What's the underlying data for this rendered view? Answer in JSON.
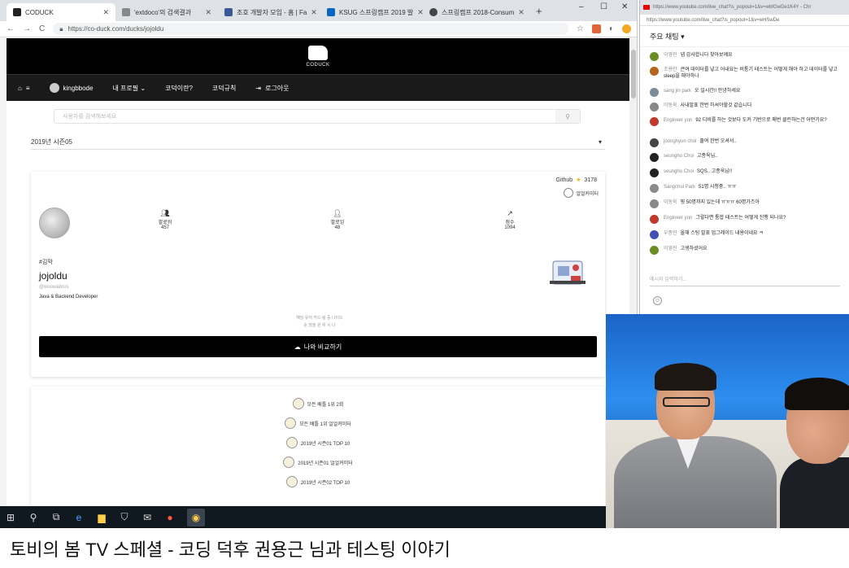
{
  "browser": {
    "tabs": [
      {
        "label": "CODUCK",
        "color": "#222222",
        "active": true
      },
      {
        "label": "'extdoco'의 검색결과",
        "color": "#888888"
      },
      {
        "label": "조호 개발자 모임 - 홈 | Fa",
        "color": "#3b5998"
      },
      {
        "label": "KSUG 스프링캠프 2019 발",
        "color": "#0a66c2"
      },
      {
        "label": "스프링캠프 2018-Consum",
        "color": "#444444"
      }
    ],
    "new_tab": "+",
    "win_min": "–",
    "win_max": "☐",
    "win_close": "✕",
    "url": "https://co-duck.com/ducks/jojoldu",
    "back": "←",
    "forward": "→",
    "reload": "C",
    "star": "☆"
  },
  "site": {
    "logo_text": "CODUCK",
    "nav": [
      "⌂",
      "kingbbode",
      "내 프로필 ⌄",
      "코덕이란?",
      "코덕규칙",
      "로그아웃"
    ],
    "search_placeholder": "사용자를 검색해보세요",
    "search_icon": "⚲",
    "season": "2019년 시즌05",
    "season_caret": "▾"
  },
  "profile": {
    "github_label": "Github",
    "github_stars": "3178",
    "badge_label": "얼얼커미터",
    "stats": [
      {
        "icon": "people-icon",
        "label": "팔로워",
        "value": "457"
      },
      {
        "icon": "person-add-icon",
        "label": "팔로잉",
        "value": "48"
      },
      {
        "icon": "trend-icon",
        "label": "점수",
        "value": "1094"
      }
    ],
    "hashtag": "#김막",
    "username": "jojoldu",
    "handle": "@woowabros",
    "role": "Java & Backend Developer",
    "compare_hint_1": "해당 유저 카드 링 중 나이드",
    "compare_hint_2": "순 점을 원 위 시 나",
    "compare_button": "나와 비교하기"
  },
  "awards": [
    "모든 배틀 1위 2회",
    "모든 배틀 1위 얼얼커미터",
    "2019년 시즌01 TOP 10",
    "2019년 시즌01 얼얼커미터",
    "2019년 시즌02 TOP 10"
  ],
  "chat": {
    "window_title": "https://www.youtube.com/live_chat?is_popout=1&v=wbfGwDe1K4Y - Chr",
    "url": "https://www.youtube.com/live_chat?is_popout=1&v=wHSwDe",
    "header": "주요 채팅 ▾",
    "messages": [
      {
        "author": "이영진",
        "text": "넵 감사합니다 찾아보께요",
        "color": "#6b8e23"
      },
      {
        "author": "조용만",
        "text": "큰여 데이터를 넣고 어내요는 비통기 테스트는 어떻게 해야 하고 데이터를 넣고 sleep을 해야하나",
        "color": "#b5651d"
      },
      {
        "author": "sang jin park",
        "text": "오 일시간!! 안녕하세요",
        "color": "#7a8b9a"
      },
      {
        "author": "이동욱",
        "text": "사내발표 한번 하셔야할것 같습니다",
        "color": "#888888"
      },
      {
        "author": "Engineer yun",
        "text": "92 디비를 하는 것보다 도커 기반으로 매번 클린하는건 어떤가요?",
        "color": "#c0392b"
      },
      {
        "author": "joonghyun choi",
        "text": "줄여 한번 오셔서..",
        "color": "#444444"
      },
      {
        "author": "seungho Choi",
        "text": "고종욱님..",
        "color": "#222222"
      },
      {
        "author": "seungho Choi",
        "text": "SQS.. 고종욱님!!",
        "color": "#222222"
      },
      {
        "author": "Sangchul Park",
        "text": "51명 시청중.. ㅠㅠ",
        "color": "#8a8a8a"
      },
      {
        "author": "이동욱",
        "text": "핑 50명까지 있는데 ㅠㅠㅠ 60명가즈아",
        "color": "#888888"
      },
      {
        "author": "Engineer yun",
        "text": "그렇다면 통합 테스트는 어떻게 진행 되나요?",
        "color": "#c0392b"
      },
      {
        "author": "우종진",
        "text": "올해 스팅 발표 업그레이드 내용이네요 ㅋ",
        "color": "#3f51b5"
      },
      {
        "author": "이영진",
        "text": "고생하셨어요",
        "color": "#6b8e23"
      }
    ],
    "input_placeholder": "메시지 입력하기...",
    "emoji": "☺"
  },
  "taskbar": {
    "start": "⊞",
    "search": "⚲",
    "taskview": "⧉",
    "edge": "e",
    "explorer": "▆",
    "store": "⛉",
    "mail": "✉",
    "app1": "●",
    "chrome": "◉"
  },
  "video_title": "토비의 봄 TV 스페셜 - 코딩 덕후 권용근 님과 테스팅 이야기"
}
